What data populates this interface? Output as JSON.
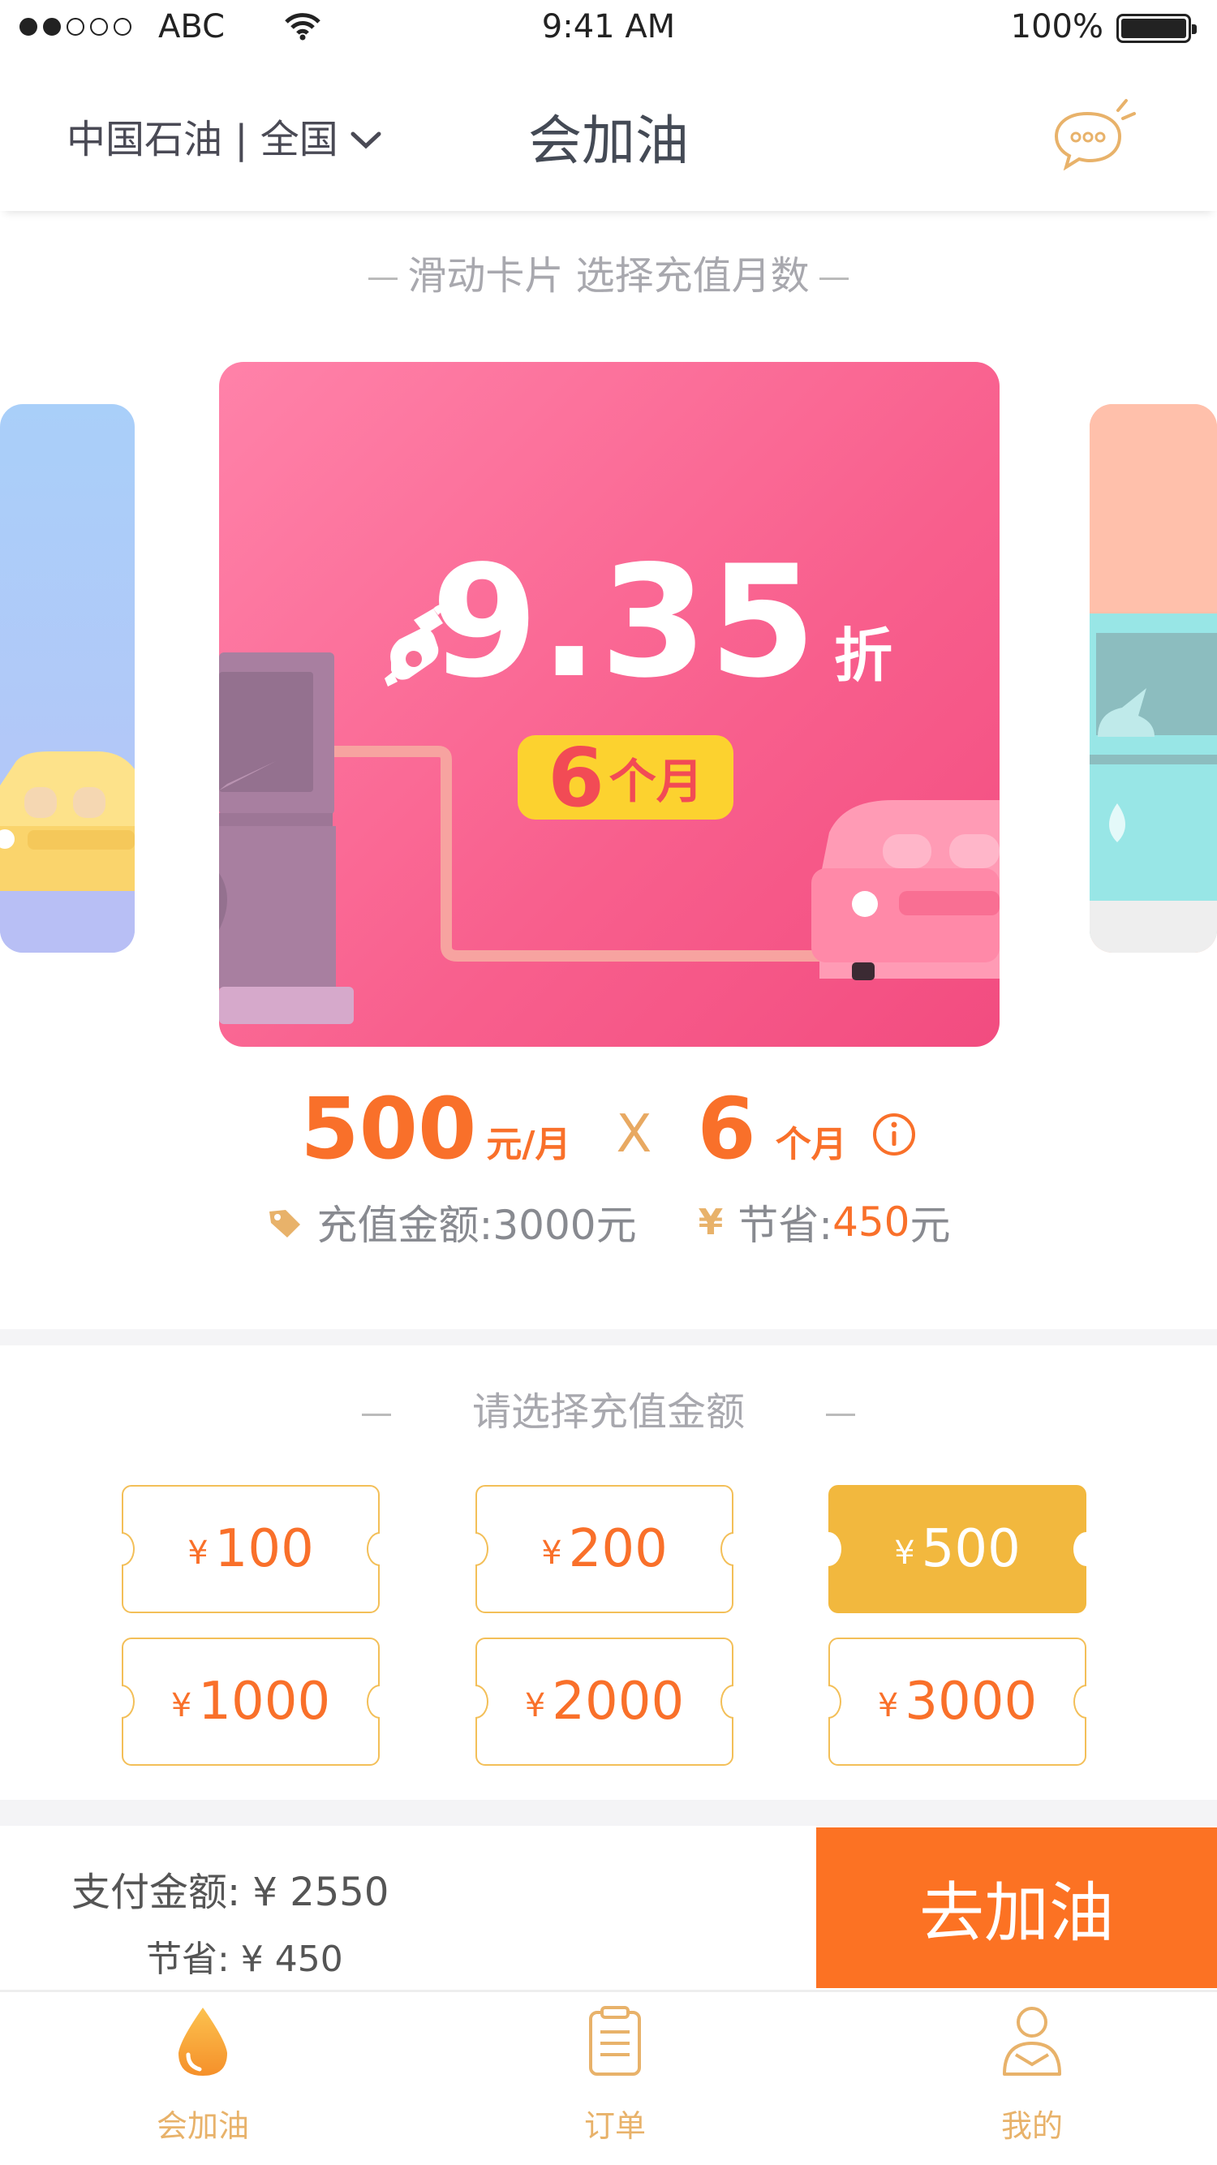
{
  "status": {
    "carrier": "ABC",
    "time": "9:41 AM",
    "battery": "100%"
  },
  "nav": {
    "region": "中国石油 | 全国",
    "title": "会加油"
  },
  "cards": {
    "hint": "滑动卡片 选择充值月数",
    "discount_value": "9.35",
    "discount_unit": "折",
    "months_value": "6",
    "months_unit": "个月"
  },
  "plan": {
    "monthly_amount": "500",
    "monthly_unit": "元/月",
    "times": "X",
    "months": "6",
    "months_unit": "个月",
    "recharge_label": "充值金额:3000元",
    "save_label": "节省:",
    "save_value": "450",
    "save_unit": "元"
  },
  "amounts": {
    "title": "请选择充值金额",
    "currency": "¥",
    "options": [
      "100",
      "200",
      "500",
      "1000",
      "2000",
      "3000"
    ],
    "selected": "500"
  },
  "payment": {
    "pay_label": "支付金额: ¥ 2550",
    "save_label": "节省: ¥ 450",
    "go_button": "去加油"
  },
  "tabs": [
    {
      "label": "会加油",
      "active": true
    },
    {
      "label": "订单",
      "active": false
    },
    {
      "label": "我的",
      "active": false
    }
  ],
  "colors": {
    "accent": "#fc7223",
    "gold": "#f2b83e",
    "card_pink": "#f85f8d",
    "badge_yellow": "#fcd22f"
  }
}
